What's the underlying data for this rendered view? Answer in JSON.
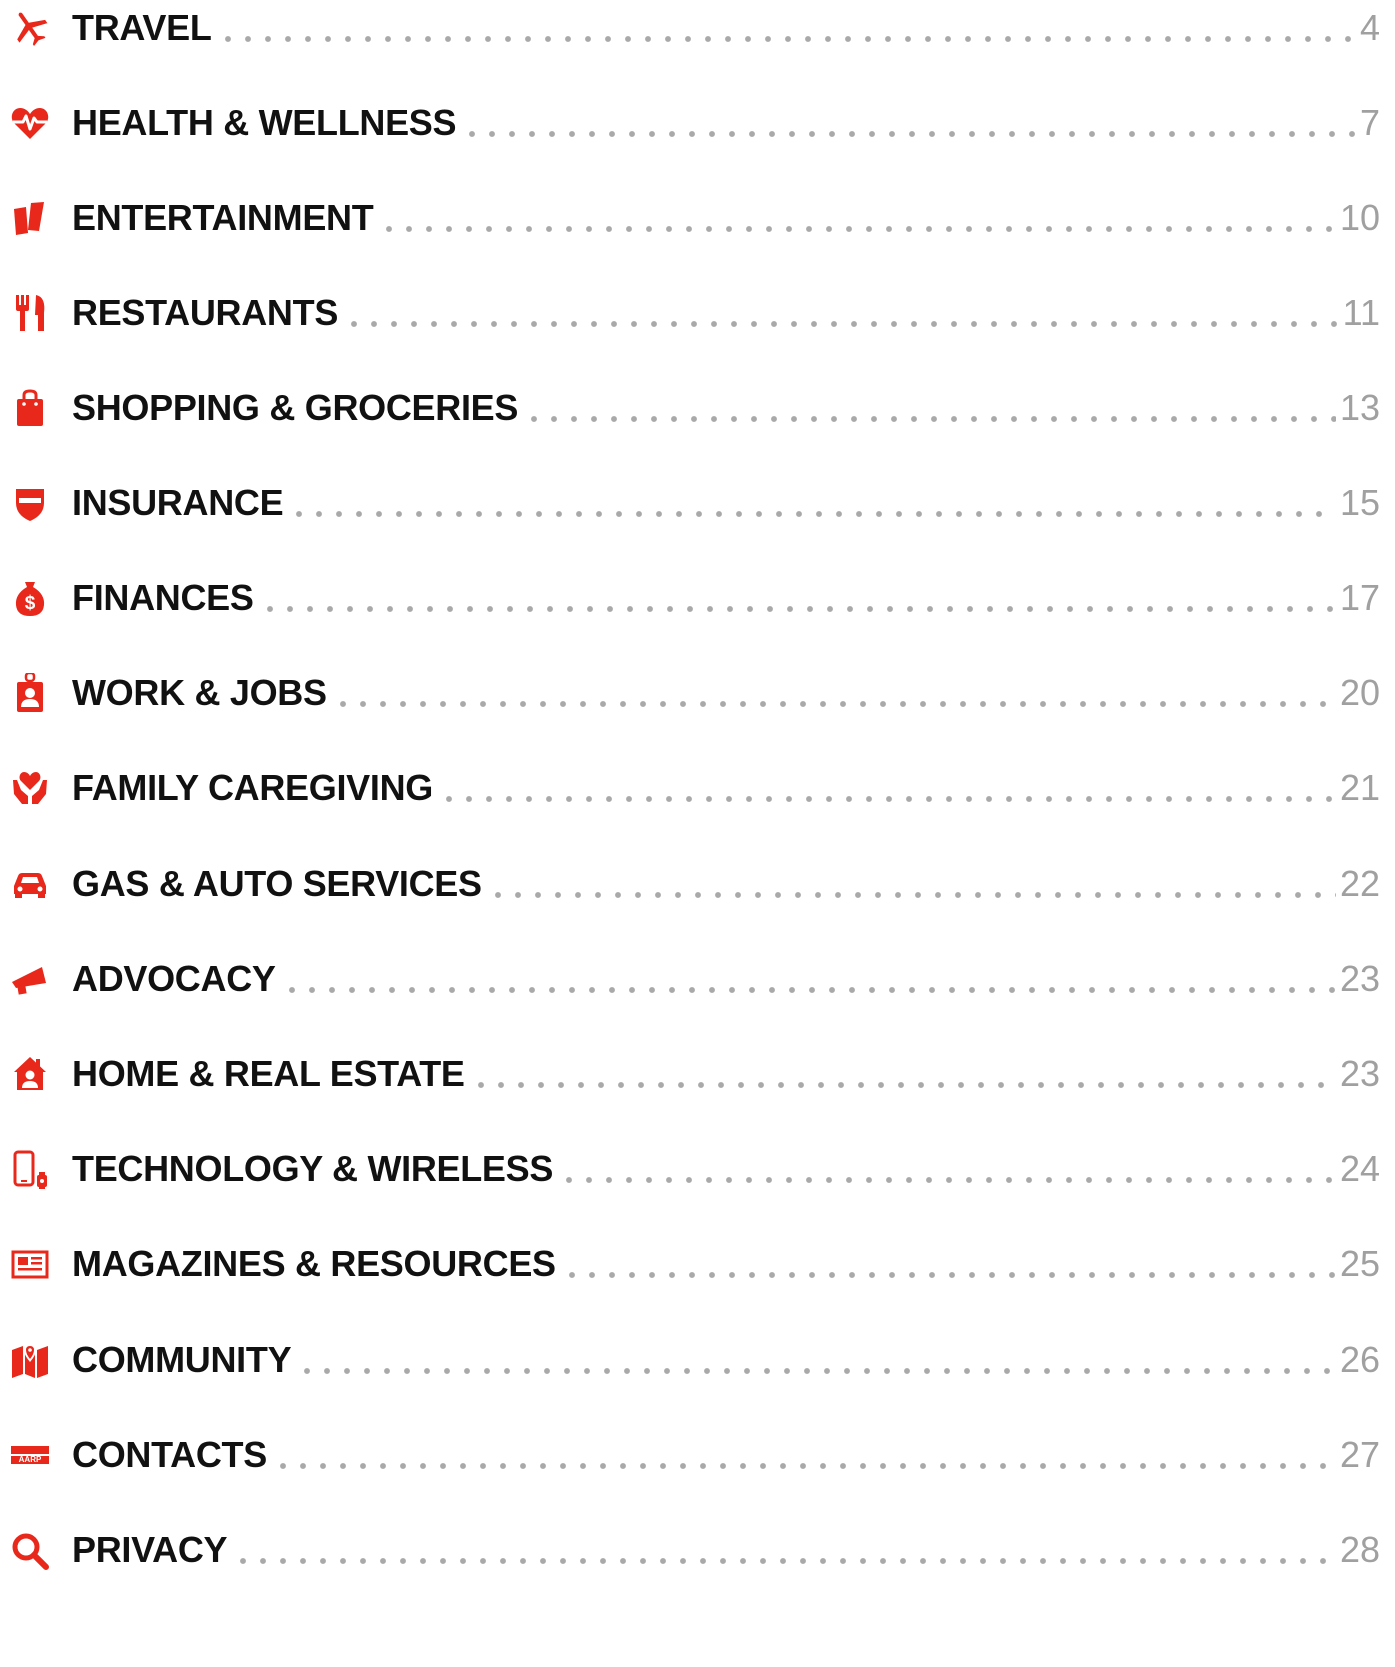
{
  "accent_color": "#e8281b",
  "entries": [
    {
      "label": "TRAVEL",
      "page": "4",
      "icon": "airplane-icon"
    },
    {
      "label": "HEALTH & WELLNESS",
      "page": "7",
      "icon": "heart-pulse-icon"
    },
    {
      "label": "ENTERTAINMENT",
      "page": "10",
      "icon": "tickets-icon"
    },
    {
      "label": "RESTAURANTS",
      "page": "11",
      "icon": "fork-knife-icon"
    },
    {
      "label": "SHOPPING & GROCERIES",
      "page": "13",
      "icon": "shopping-bag-icon"
    },
    {
      "label": "INSURANCE",
      "page": "15",
      "icon": "shield-icon"
    },
    {
      "label": "FINANCES",
      "page": "17",
      "icon": "money-bag-icon"
    },
    {
      "label": "WORK & JOBS",
      "page": "20",
      "icon": "id-badge-icon"
    },
    {
      "label": "FAMILY CAREGIVING",
      "page": "21",
      "icon": "hands-heart-icon"
    },
    {
      "label": "GAS & AUTO SERVICES",
      "page": "22",
      "icon": "car-icon"
    },
    {
      "label": "ADVOCACY",
      "page": "23",
      "icon": "megaphone-icon"
    },
    {
      "label": "HOME & REAL ESTATE",
      "page": "23",
      "icon": "house-person-icon"
    },
    {
      "label": "TECHNOLOGY & WIRELESS",
      "page": "24",
      "icon": "phone-watch-icon"
    },
    {
      "label": "MAGAZINES & RESOURCES",
      "page": "25",
      "icon": "newspaper-icon"
    },
    {
      "label": "COMMUNITY",
      "page": "26",
      "icon": "map-pin-icon"
    },
    {
      "label": "CONTACTS",
      "page": "27",
      "icon": "aarp-card-icon",
      "icon_text": "AARP"
    },
    {
      "label": "PRIVACY",
      "page": "28",
      "icon": "magnifier-icon"
    }
  ]
}
